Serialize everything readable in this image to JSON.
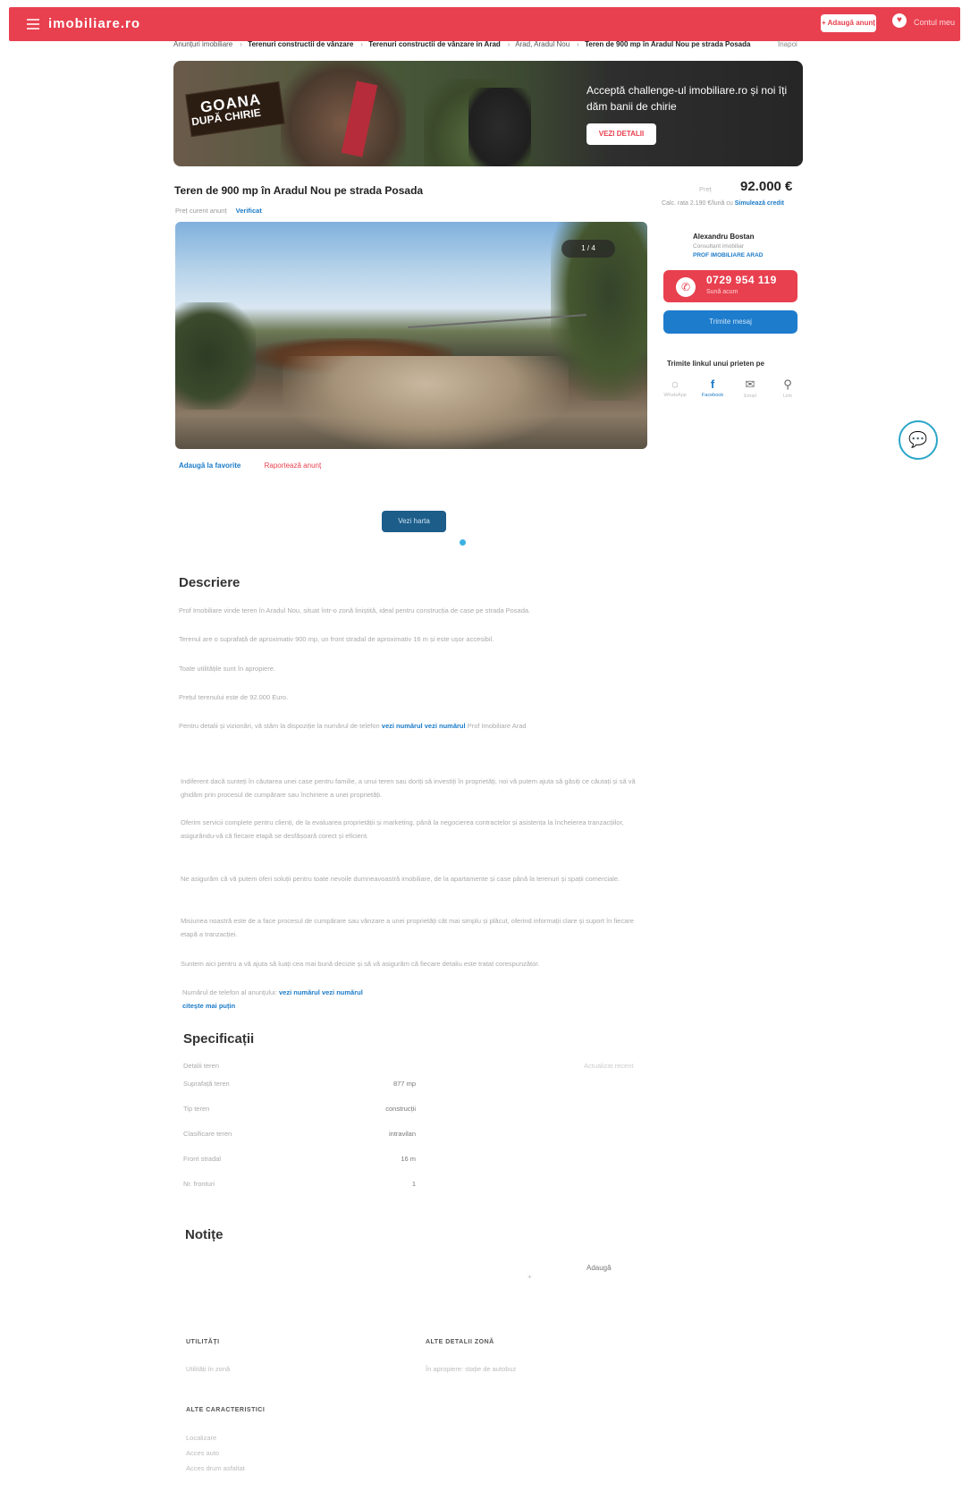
{
  "header": {
    "logo": "imobiliare.ro",
    "post_button": "+ Adaugă anunț",
    "account_label": "Contul meu"
  },
  "breadcrumb": {
    "items": [
      "Anunțuri imobiliare",
      "Terenuri constructii de vânzare",
      "Terenuri constructii de vânzare in Arad",
      "Arad, Aradul Nou",
      "Teren de 900 mp în Aradul Nou pe strada Posada"
    ],
    "back": "Înapoi"
  },
  "banner": {
    "sign_line1": "GOANA",
    "sign_line2": "DUPĂ CHIRIE",
    "headline": "Acceptă challenge-ul imobiliare.ro și noi îți dăm banii de chirie",
    "cta": "VEZI DETALII"
  },
  "listing": {
    "title": "Teren de 900 mp în Aradul Nou pe strada Posada",
    "meta_left": "Preț curent anunț",
    "meta_tag": "Verificat",
    "price_label": "Preț",
    "price": "92.000 €",
    "price_sub_text": "Calc. rata 2.190 €/lună cu",
    "price_sub_link": "Simulează credit",
    "photo_count": "1 / 4"
  },
  "photo_actions": {
    "save": "Adaugă la favorite",
    "report": "Raportează anunț"
  },
  "map_button": "Vezi harta",
  "agent": {
    "name": "Alexandru Bostan",
    "role": "Consultant imobiliar",
    "agency": "PROF IMOBILIARE ARAD",
    "phone": "0729 954 119",
    "phone_sub": "Sună acum",
    "message_button": "Trimite mesaj",
    "share_title": "Trimite linkul unui prieten pe",
    "share_items": [
      {
        "icon": "whatsapp-icon",
        "glyph": "◌",
        "label": "WhatsApp"
      },
      {
        "icon": "facebook-icon",
        "glyph": "f",
        "label": "Facebook"
      },
      {
        "icon": "email-icon",
        "glyph": "✉",
        "label": "Email"
      },
      {
        "icon": "link-icon",
        "glyph": "⚲",
        "label": "Link"
      }
    ]
  },
  "description": {
    "title": "Descriere",
    "paragraphs": [
      "Prof Imobiliare vinde teren în Aradul Nou, situat într-o zonă liniștită, ideal pentru construcția de case pe strada Posada.",
      "Terenul are o suprafață de aproximativ 900 mp, un front stradal de aproximativ 16 m și este ușor accesibil.",
      "Toate utilitățile sunt în apropiere.",
      "Prețul terenului este de 92.000 Euro.",
      "Pentru detalii și vizionări, vă stăm la dispoziție la numărul de telefon"
    ],
    "p5_link1": "vezi numărul",
    "p5_link2": "vezi numărul",
    "p5_tail": "Prof Imobiliare Arad",
    "paragraphs2": [
      "Indiferent dacă sunteți în căutarea unei case pentru familie, a unui teren sau doriți să investiți în proprietăți, noi vă putem ajuta să găsiți ce căutați și să vă ghidăm prin procesul de cumpărare sau închiriere a unei proprietăți.",
      "Oferim servicii complete pentru clienți, de la evaluarea proprietății și marketing, până la negocierea contractelor și asistența la încheierea tranzacțiilor, asigurându-vă că fiecare etapă se desfășoară corect și eficient.",
      "Ne asigurăm că vă putem oferi soluții pentru toate nevoile dumneavoastră imobiliare, de la apartamente și case până la terenuri și spații comerciale.",
      "Misiunea noastră este de a face procesul de cumpărare sau vânzare a unei proprietăți cât mai simplu și plăcut, oferind informații clare și suport în fiecare etapă a tranzacției.",
      "Suntem aici pentru a vă ajuta să luați cea mai bună decizie și să vă asigurăm că fiecare detaliu este tratat corespunzător."
    ],
    "footer_text": "Numărul de telefon al anunțului:",
    "footer_link1": "vezi numărul",
    "footer_link2": "vezi numărul",
    "footer_link3": "citește mai puțin"
  },
  "specs": {
    "title": "Specificații",
    "aside": "Actualizat recent",
    "header_label": "Detalii teren",
    "rows": [
      {
        "label": "Suprafață teren",
        "value": "877 mp"
      },
      {
        "label": "Tip teren",
        "value": "construcții"
      },
      {
        "label": "Clasificare teren",
        "value": "intravilan"
      },
      {
        "label": "Front stradal",
        "value": "16 m"
      },
      {
        "label": "Nr. fronturi",
        "value": "1"
      }
    ]
  },
  "notes": {
    "title": "Notițe",
    "add": "Adaugă",
    "dot": "+"
  },
  "extras": {
    "utilities_head": "UTILITĂȚI",
    "utilities_val": "Utilități în zonă",
    "zone_head": "ALTE DETALII ZONĂ",
    "zone_val": "În apropiere: stație de autobuz",
    "other_head": "ALTE CARACTERISTICI",
    "other_vals": [
      "Localizare",
      "Acces auto",
      "Acces drum asfaltat"
    ]
  },
  "chat_button": "chat"
}
